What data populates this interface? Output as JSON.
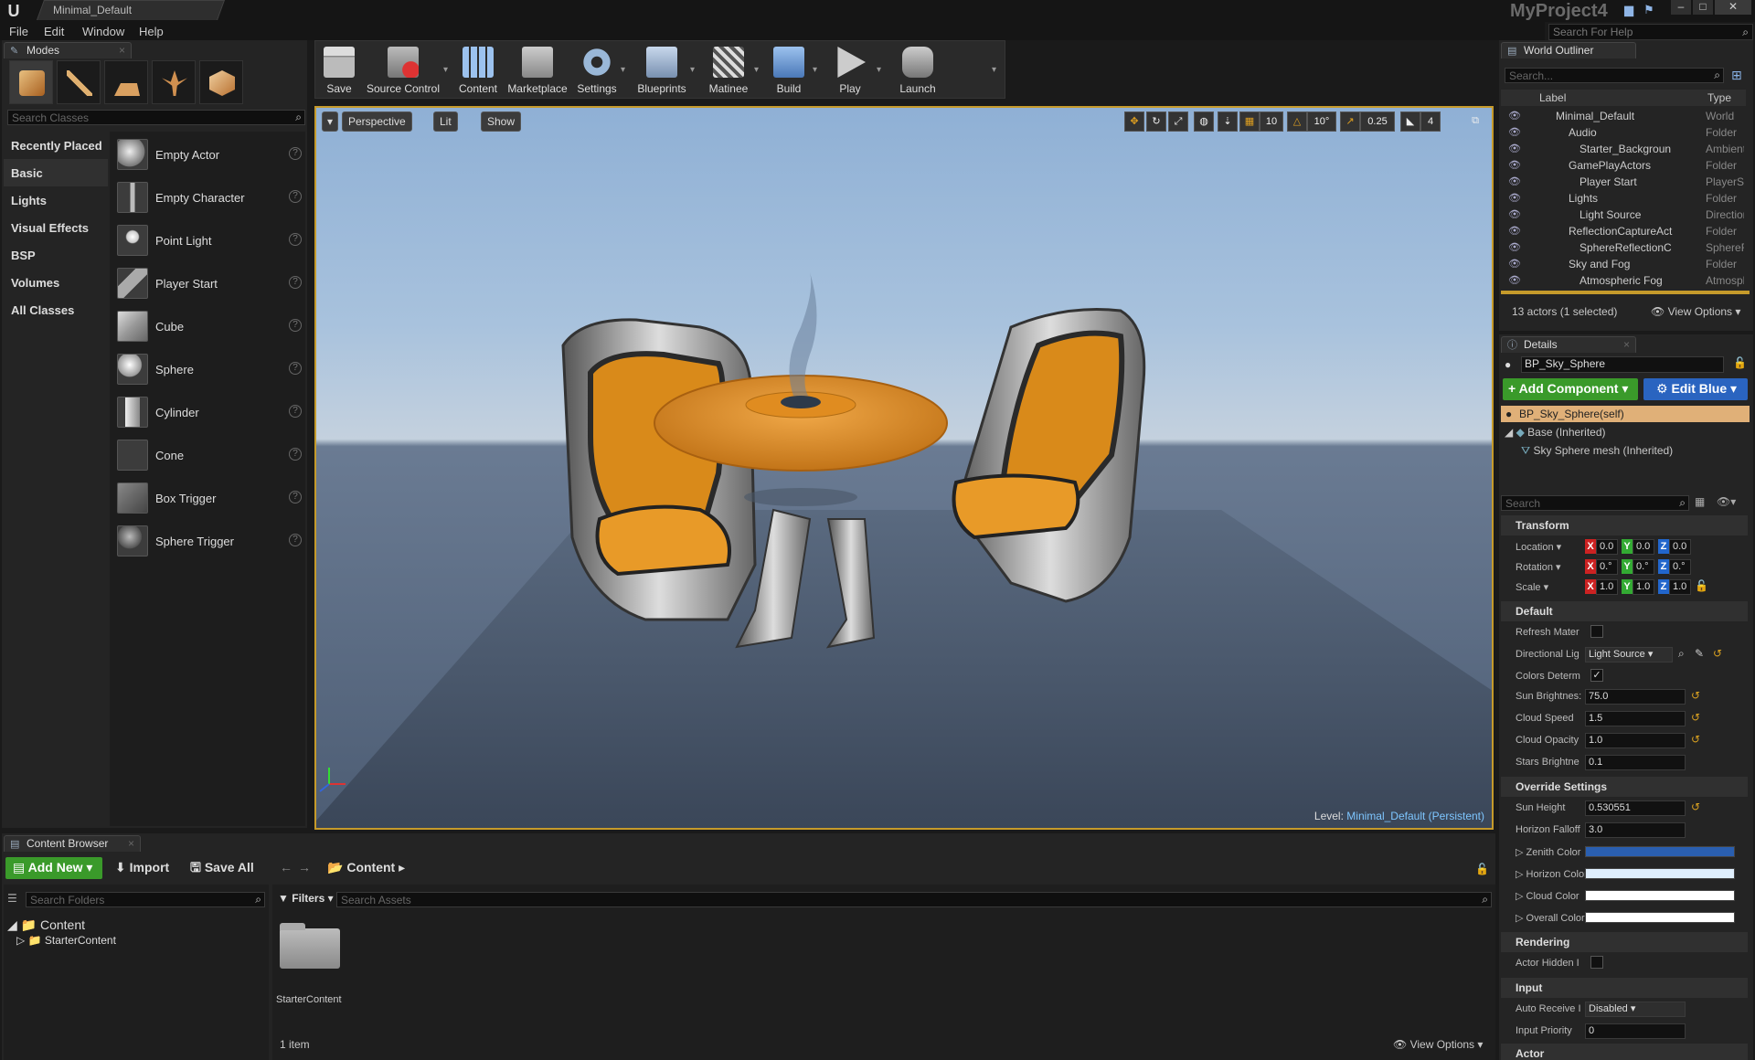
{
  "title_bar": {
    "level_tab": "Minimal_Default",
    "project_name": "MyProject4",
    "window_buttons": [
      "–",
      "□",
      "✕"
    ]
  },
  "menu": [
    "File",
    "Edit",
    "Window",
    "Help"
  ],
  "help_search": {
    "placeholder": "Search For Help"
  },
  "modes": {
    "tab": "Modes",
    "search_placeholder": "Search Classes",
    "categories": [
      "Recently Placed",
      "Basic",
      "Lights",
      "Visual Effects",
      "BSP",
      "Volumes",
      "All Classes"
    ],
    "active_category": "Basic",
    "items": [
      "Empty Actor",
      "Empty Character",
      "Point Light",
      "Player Start",
      "Cube",
      "Sphere",
      "Cylinder",
      "Cone",
      "Box Trigger",
      "Sphere Trigger"
    ]
  },
  "toolbar": {
    "buttons": [
      "Save",
      "Source Control",
      "Content",
      "Marketplace",
      "Settings",
      "Blueprints",
      "Matinee",
      "Build",
      "Play",
      "Launch"
    ]
  },
  "viewport": {
    "view_mode": "Perspective",
    "lighting_mode": "Lit",
    "show_label": "Show",
    "grid_snap": "10",
    "rotation_snap": "10°",
    "scale_snap": "0.25",
    "camera_speed": "4",
    "level_prefix": "Level:",
    "level_name": "Minimal_Default (Persistent)"
  },
  "outliner": {
    "tab": "World Outliner",
    "search_placeholder": "Search...",
    "col_label": "Label",
    "col_type": "Type",
    "rows": [
      {
        "label": "Minimal_Default",
        "type": "World"
      },
      {
        "label": "Audio",
        "type": "Folder"
      },
      {
        "label": "Starter_Backgroun",
        "type": "AmbientSou"
      },
      {
        "label": "GamePlayActors",
        "type": "Folder"
      },
      {
        "label": "Player Start",
        "type": "PlayerStart"
      },
      {
        "label": "Lights",
        "type": "Folder"
      },
      {
        "label": "Light Source",
        "type": "DirectionalL"
      },
      {
        "label": "ReflectionCaptureAct",
        "type": "Folder"
      },
      {
        "label": "SphereReflectionC",
        "type": "SphereReflec"
      },
      {
        "label": "Sky and Fog",
        "type": "Folder"
      },
      {
        "label": "Atmospheric Fog",
        "type": "Atmospheric"
      }
    ],
    "actor_count": "13 actors (1 selected)",
    "view_options": "View Options"
  },
  "details": {
    "tab": "Details",
    "actor_name": "BP_Sky_Sphere",
    "add_component": "Add Component",
    "edit_blueprint": "Edit Blue",
    "self_component": "BP_Sky_Sphere(self)",
    "base_component": "Base (Inherited)",
    "mesh_component": "Sky Sphere mesh (Inherited)",
    "search_placeholder": "Search",
    "transform": {
      "title": "Transform",
      "location_label": "Location",
      "rotation_label": "Rotation",
      "scale_label": "Scale",
      "location": [
        "0.0",
        "0.0",
        "0.0"
      ],
      "rotation": [
        "0.°",
        "0.°",
        "0.°"
      ],
      "scale": [
        "1.0",
        "1.0",
        "1.0"
      ]
    },
    "default": {
      "title": "Default",
      "refresh_material": "Refresh Mater",
      "directional_light": "Directional Lig",
      "directional_light_value": "Light Source",
      "colors_determined": "Colors Determ",
      "sun_brightness": "Sun Brightnes:",
      "sun_brightness_value": "75.0",
      "cloud_speed": "Cloud Speed",
      "cloud_speed_value": "1.5",
      "cloud_opacity": "Cloud Opacity",
      "cloud_opacity_value": "1.0",
      "stars_brightness": "Stars Brightne",
      "stars_brightness_value": "0.1"
    },
    "override": {
      "title": "Override Settings",
      "sun_height": "Sun Height",
      "sun_height_value": "0.530551",
      "horizon_falloff": "Horizon Falloff",
      "horizon_falloff_value": "3.0",
      "zenith_color": "Zenith Color",
      "horizon_color": "Horizon Color",
      "cloud_color": "Cloud Color",
      "overall_color": "Overall Color",
      "zenith_hex": "#2a5fb0",
      "horizon_hex": "#dfeefc",
      "cloud_hex": "#ffffff",
      "overall_hex": "#ffffff"
    },
    "rendering": {
      "title": "Rendering",
      "actor_hidden": "Actor Hidden I"
    },
    "input": {
      "title": "Input",
      "auto_receive": "Auto Receive I",
      "auto_receive_value": "Disabled",
      "input_priority": "Input Priority",
      "input_priority_value": "0"
    },
    "actor": {
      "title": "Actor"
    }
  },
  "content_browser": {
    "tab": "Content Browser",
    "add_new": "Add New",
    "import": "Import",
    "save_all": "Save All",
    "path_root": "Content",
    "folder_search_placeholder": "Search Folders",
    "filters": "Filters",
    "asset_search_placeholder": "Search Assets",
    "tree": [
      "Content",
      "StarterContent"
    ],
    "assets": [
      "StarterContent"
    ],
    "item_count": "1 item",
    "view_options": "View Options"
  },
  "colors": {
    "accent_orange": "#c59a2b",
    "add_green": "#3a9a2a",
    "edit_blue": "#2a64c0",
    "selection": "#e0b078",
    "link": "#7ec6ff"
  }
}
